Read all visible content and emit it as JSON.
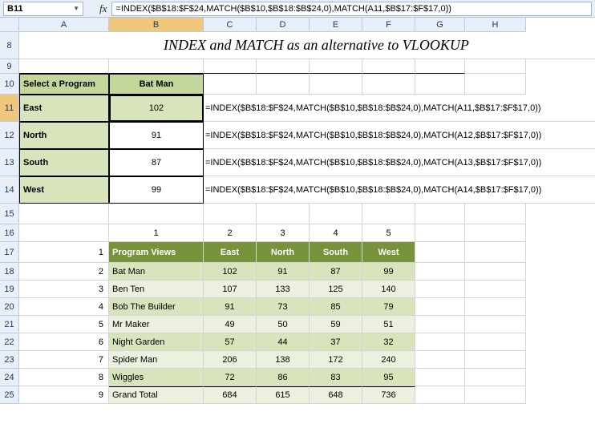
{
  "name_box": "B11",
  "formula_bar": "=INDEX($B$18:$F$24,MATCH($B$10,$B$18:$B$24,0),MATCH(A11,$B$17:$F$17,0))",
  "fx_label": "fx",
  "columns": [
    "A",
    "B",
    "C",
    "D",
    "E",
    "F",
    "G",
    "H"
  ],
  "rows": [
    "8",
    "9",
    "10",
    "11",
    "12",
    "13",
    "14",
    "15",
    "16",
    "17",
    "18",
    "19",
    "20",
    "21",
    "22",
    "23",
    "24",
    "25"
  ],
  "title": "INDEX and MATCH as an alternative to VLOOKUP",
  "selector": {
    "label": "Select a Program",
    "value": "Bat Man"
  },
  "regions": [
    {
      "name": "East",
      "value": "102",
      "formula": "=INDEX($B$18:$F$24,MATCH($B$10,$B$18:$B$24,0),MATCH(A11,$B$17:$F$17,0))"
    },
    {
      "name": "North",
      "value": "91",
      "formula": "=INDEX($B$18:$F$24,MATCH($B$10,$B$18:$B$24,0),MATCH(A12,$B$17:$F$17,0))"
    },
    {
      "name": "South",
      "value": "87",
      "formula": "=INDEX($B$18:$F$24,MATCH($B$10,$B$18:$B$24,0),MATCH(A13,$B$17:$F$17,0))"
    },
    {
      "name": "West",
      "value": "99",
      "formula": "=INDEX($B$18:$F$24,MATCH($B$10,$B$18:$B$24,0),MATCH(A14,$B$17:$F$17,0))"
    }
  ],
  "col_index_labels": [
    "1",
    "2",
    "3",
    "4",
    "5"
  ],
  "row_index_labels": [
    "1",
    "2",
    "3",
    "4",
    "5",
    "6",
    "7",
    "8",
    "9"
  ],
  "table_header": [
    "Program Views",
    "East",
    "North",
    "South",
    "West"
  ],
  "chart_data": {
    "type": "table",
    "categories": [
      "East",
      "North",
      "South",
      "West"
    ],
    "rows": [
      {
        "name": "Bat Man",
        "values": [
          102,
          91,
          87,
          99
        ]
      },
      {
        "name": "Ben Ten",
        "values": [
          107,
          133,
          125,
          140
        ]
      },
      {
        "name": "Bob The Builder",
        "values": [
          91,
          73,
          85,
          79
        ]
      },
      {
        "name": "Mr Maker",
        "values": [
          49,
          50,
          59,
          51
        ]
      },
      {
        "name": "Night Garden",
        "values": [
          57,
          44,
          37,
          32
        ]
      },
      {
        "name": "Spider Man",
        "values": [
          206,
          138,
          172,
          240
        ]
      },
      {
        "name": "Wiggles",
        "values": [
          72,
          86,
          83,
          95
        ]
      }
    ],
    "total": {
      "name": "Grand Total",
      "values": [
        684,
        615,
        648,
        736
      ]
    }
  }
}
